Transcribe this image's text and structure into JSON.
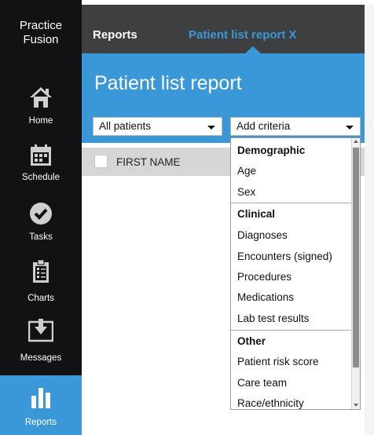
{
  "brand": {
    "line1": "Practice",
    "line2": "Fusion"
  },
  "nav": [
    {
      "label": "Home",
      "icon": "home-icon"
    },
    {
      "label": "Schedule",
      "icon": "calendar-icon"
    },
    {
      "label": "Tasks",
      "icon": "checkmark-icon"
    },
    {
      "label": "Charts",
      "icon": "clipboard-icon"
    },
    {
      "label": "Messages",
      "icon": "inbox-icon"
    },
    {
      "label": "Reports",
      "icon": "bar-chart-icon",
      "active": true
    }
  ],
  "tabs": {
    "reports": "Reports",
    "patient_list_report": "Patient list report X"
  },
  "page_title": "Patient list report",
  "filters": {
    "patients_select": "All patients",
    "criteria_select": "Add criteria"
  },
  "table": {
    "first_name_header": "FIRST NAME"
  },
  "criteria_menu": {
    "demographic": {
      "label": "Demographic",
      "items": [
        "Age",
        "Sex"
      ]
    },
    "clinical": {
      "label": "Clinical",
      "items": [
        "Diagnoses",
        "Encounters (signed)",
        "Procedures",
        "Medications",
        "Lab test results"
      ]
    },
    "other": {
      "label": "Other",
      "items": [
        "Patient risk score",
        "Care team",
        "Race/ethnicity"
      ]
    }
  },
  "colors": {
    "accent": "#3a98d8",
    "sidebar": "#111213",
    "topbar": "#3e3f41"
  }
}
